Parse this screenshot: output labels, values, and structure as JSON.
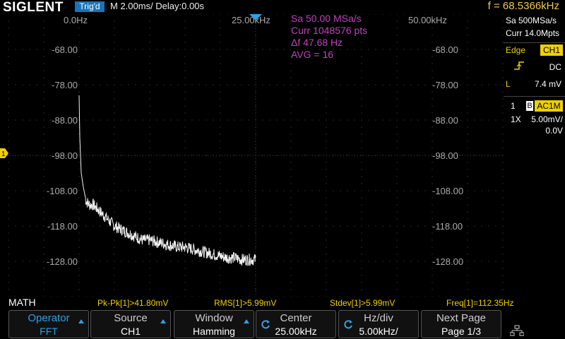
{
  "header": {
    "logo": "SIGLENT",
    "trigger_status": "Trig'd",
    "timebase": "M 2.00ms/ Delay:0.00s",
    "frequency": "f = 68.5366kHz"
  },
  "right_panel": {
    "sample_rate": "Sa 500MSa/s",
    "memory_depth": "Curr 14.0Mpts",
    "trigger_type": "Edge",
    "trigger_source": "CH1",
    "coupling": "DC",
    "level_label": "L",
    "level_value": "7.4 mV",
    "channel_number": "1",
    "bandwidth_flag": "B",
    "channel_coupling": "AC1M",
    "probe": "1X",
    "volts_per_div": "5.00mV/",
    "offset": "0.0V"
  },
  "fft": {
    "freq_start": "0.0Hz",
    "freq_center": "25.00kHz",
    "freq_end": "50.00kHz",
    "sample_info": "Sa 50.00 MSa/s",
    "points_info": "Curr 1048576 pts",
    "delta_f": "Δf 47.68 Hz",
    "avg": "AVG = 16",
    "y_labels": [
      "-68.00",
      "-78.00",
      "-88.00",
      "-98.00",
      "-108.00",
      "-118.00",
      "-128.00"
    ],
    "channel_marker": "1"
  },
  "chart_data": {
    "type": "line",
    "title": "",
    "xlabel": "",
    "ylabel": "",
    "xlim": [
      0,
      50000
    ],
    "ylim": [
      -138,
      -58
    ],
    "x_unit": "Hz",
    "y_unit": "dBV",
    "series": [
      {
        "color": "#ffffff",
        "x": [
          0,
          100,
          300,
          600,
          1000,
          1500,
          2000,
          3000,
          4000,
          5000,
          6000,
          7000,
          8000,
          9000,
          10000,
          11000,
          12000,
          13000,
          14000,
          15000,
          16000,
          17000,
          18000,
          19000,
          20000,
          21000,
          22000,
          23000,
          24000,
          25000
        ],
        "y": [
          -81,
          -93,
          -103,
          -107,
          -111,
          -112,
          -112,
          -114,
          -116,
          -118,
          -119,
          -120,
          -121,
          -122,
          -122,
          -122.5,
          -123,
          -123.5,
          -124,
          -124,
          -124.5,
          -125,
          -125.5,
          -126,
          -126.5,
          -127,
          -127,
          -127.5,
          -127.5,
          -127.5
        ]
      }
    ]
  },
  "measurements": {
    "math_label": "MATH",
    "pkpk": "Pk-Pk[1]>41.80mV",
    "rms": "RMS[1]>5.99mV",
    "stdev": "Stdev[1]>5.99mV",
    "freq": "Freq[1]=112.35Hz"
  },
  "softkeys": [
    {
      "label": "Operator",
      "value": "FFT"
    },
    {
      "label": "Source",
      "value": "CH1"
    },
    {
      "label": "Window",
      "value": "Hamming"
    },
    {
      "label": "Center",
      "value": "25.00kHz"
    },
    {
      "label": "Hz/div",
      "value": "5.00kHz/"
    },
    {
      "label": "Next Page",
      "value": "Page 1/3"
    }
  ],
  "colors": {
    "accent": "#1a74b8",
    "trigger_yellow": "#f0d000",
    "info_magenta": "#c040c0",
    "freq_orange": "#f0c850"
  }
}
